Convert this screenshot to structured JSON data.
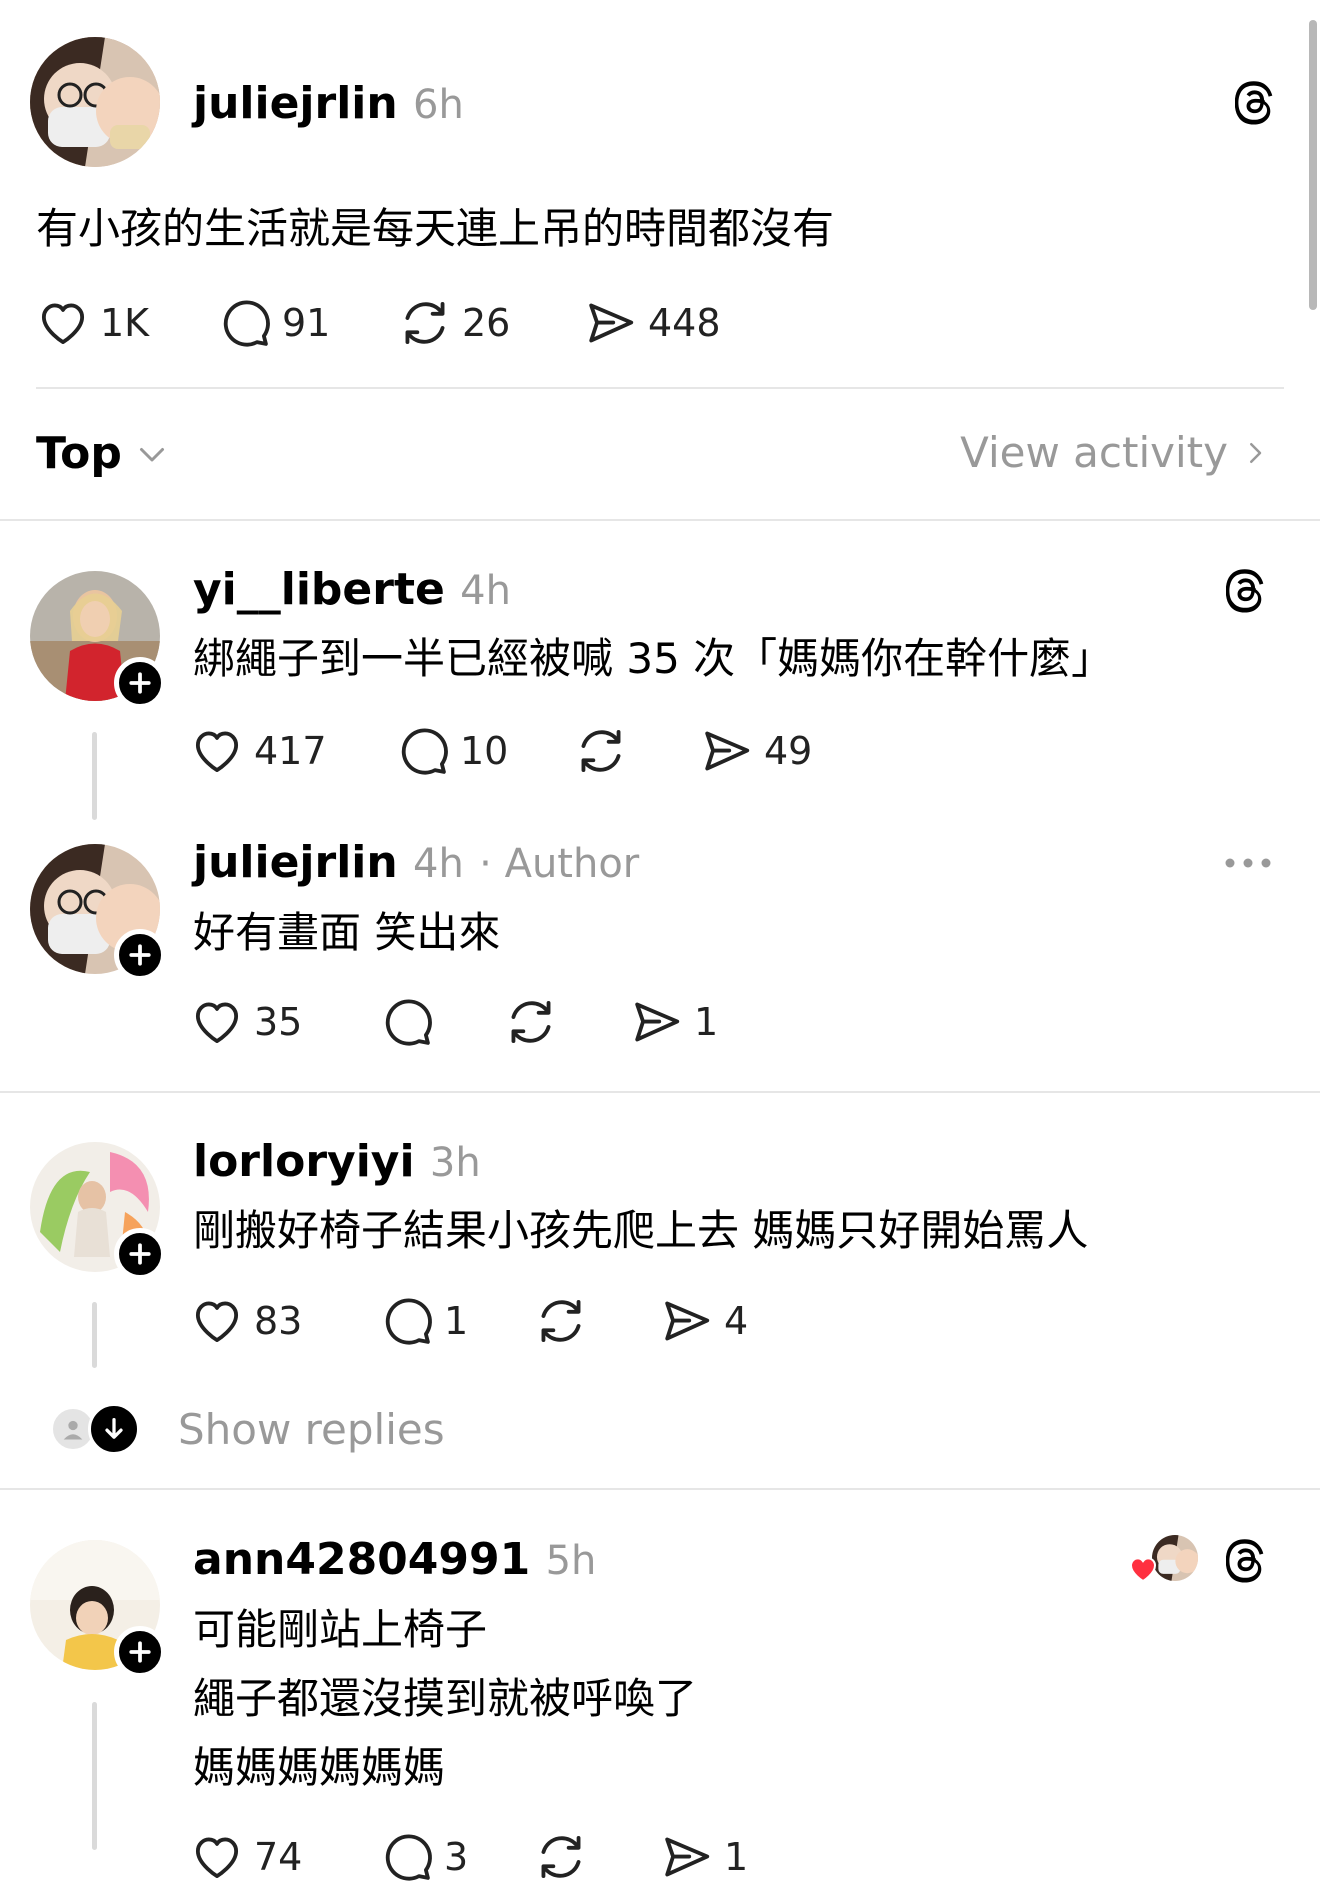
{
  "post": {
    "username": "juliejrlin",
    "time": "6h",
    "text": "有小孩的生活就是每天連上吊的時間都沒有",
    "likes": "1K",
    "comments": "91",
    "reposts": "26",
    "shares": "448"
  },
  "sort": {
    "label": "Top",
    "view_activity": "View activity"
  },
  "replies": [
    {
      "username": "yi__liberte",
      "time": "4h",
      "text": "綁繩子到一半已經被喊 35 次「媽媽你在幹什麼」",
      "likes": "417",
      "comments": "10",
      "reposts": "",
      "shares": "49"
    },
    {
      "username": "juliejrlin",
      "time": "4h",
      "author_tag": "· Author",
      "text": "好有畫面 笑出來",
      "likes": "35",
      "comments": "",
      "reposts": "",
      "shares": "1"
    },
    {
      "username": "lorloryiyi",
      "time": "3h",
      "text": "剛搬好椅子結果小孩先爬上去 媽媽只好開始罵人",
      "likes": "83",
      "comments": "1",
      "reposts": "",
      "shares": "4",
      "show_replies": "Show replies"
    },
    {
      "username": "ann42804991",
      "time": "5h",
      "text_lines": [
        "可能剛站上椅子",
        "繩子都還沒摸到就被呼喚了",
        "媽媽媽媽媽媽"
      ],
      "likes": "74",
      "comments": "3",
      "reposts": "",
      "shares": "1"
    }
  ],
  "colors": {
    "text": "#000000",
    "meta": "#999999",
    "divider": "#e6e6e6",
    "heart": "#ff3040"
  },
  "icons": [
    "threads-logo-icon",
    "heart-icon",
    "comment-icon",
    "repost-icon",
    "share-icon",
    "plus-icon",
    "chevron-down-icon",
    "chevron-right-icon",
    "more-icon",
    "arrow-down-icon"
  ]
}
